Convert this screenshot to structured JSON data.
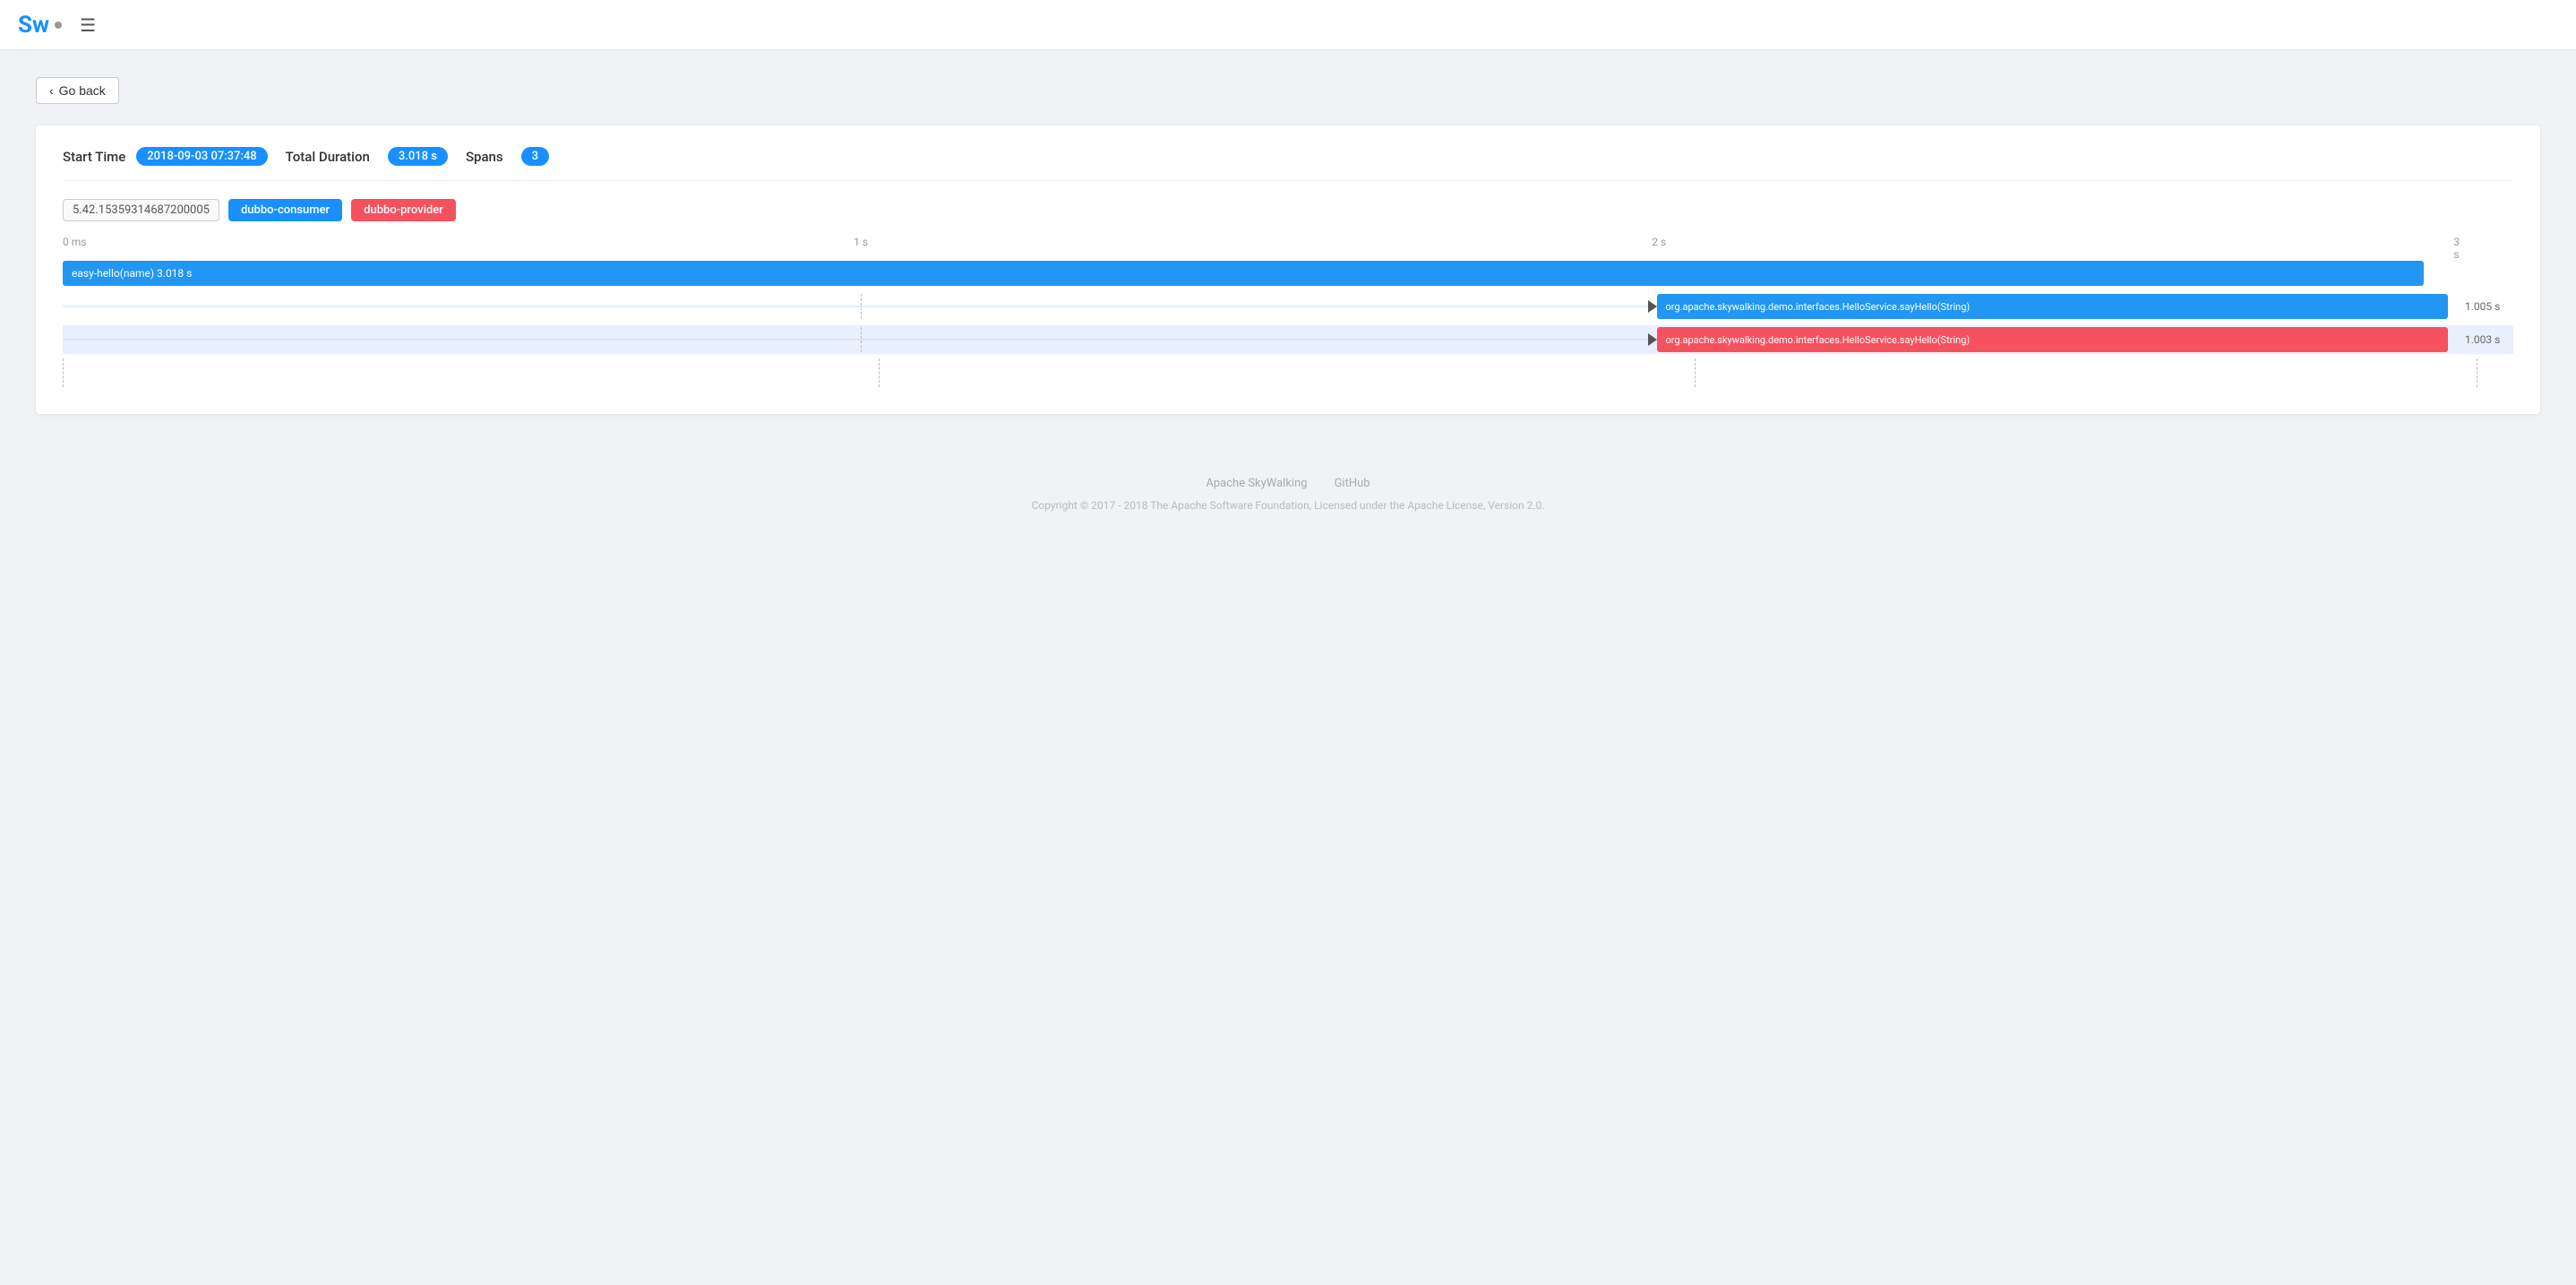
{
  "header": {
    "logo": "Sw",
    "menu_icon": "☰"
  },
  "go_back": {
    "label": "Go back",
    "chevron": "‹"
  },
  "trace_info": {
    "start_time_label": "Start Time",
    "start_time_value": "2018-09-03 07:37:48",
    "total_duration_label": "Total Duration",
    "total_duration_value": "3.018 s",
    "spans_label": "Spans",
    "spans_count": "3",
    "trace_id": "5.42.15359314687200005"
  },
  "legend": {
    "consumer": "dubbo-consumer",
    "provider": "dubbo-provider"
  },
  "time_axis": {
    "labels": [
      "0 ms",
      "1 s",
      "2 s",
      "3 s"
    ],
    "positions": [
      0,
      33.3,
      66.6,
      100
    ]
  },
  "spans": [
    {
      "id": "span-1",
      "label": "easy-hello(name) 3.018 s",
      "color": "#2196f3",
      "left_pct": 0,
      "width_pct": 98.5,
      "duration": "",
      "type": "main",
      "has_marker": false,
      "bg": "white"
    },
    {
      "id": "span-2",
      "label": "org.apache.skywalking.demo.interfaces.HelloService.sayHello(String)",
      "color": "#2196f3",
      "left_pct": 66.5,
      "width_pct": 33.2,
      "duration": "1.005 s",
      "type": "child",
      "has_marker": true,
      "bg": "white"
    },
    {
      "id": "span-3",
      "label": "org.apache.skywalking.demo.interfaces.HelloService.sayHello(String)",
      "color": "#f5515f",
      "left_pct": 66.5,
      "width_pct": 33.0,
      "duration": "1.003 s",
      "type": "child",
      "has_marker": true,
      "bg": "light"
    }
  ],
  "footer": {
    "link1": "Apache SkyWalking",
    "link2": "GitHub",
    "copyright": "Copyright © 2017 - 2018 The Apache Software Foundation, Licensed under the Apache License, Version 2.0."
  }
}
